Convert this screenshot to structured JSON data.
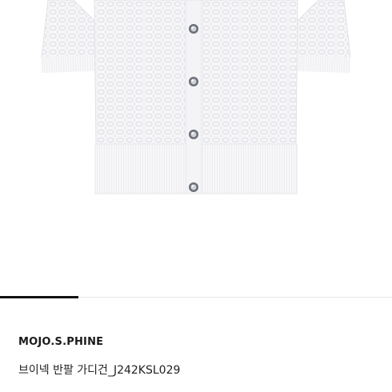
{
  "product": {
    "brand": "MOJO.S.PHINE",
    "name": "브이넥 반팔 가디건_J242KSL029",
    "button_count": 4
  },
  "carousel": {
    "progress_fraction": 0.2
  },
  "colors": {
    "background": "#ffffff",
    "garment": "#f6f6f8",
    "indicator": "#111111",
    "track": "#e6e6e6"
  }
}
